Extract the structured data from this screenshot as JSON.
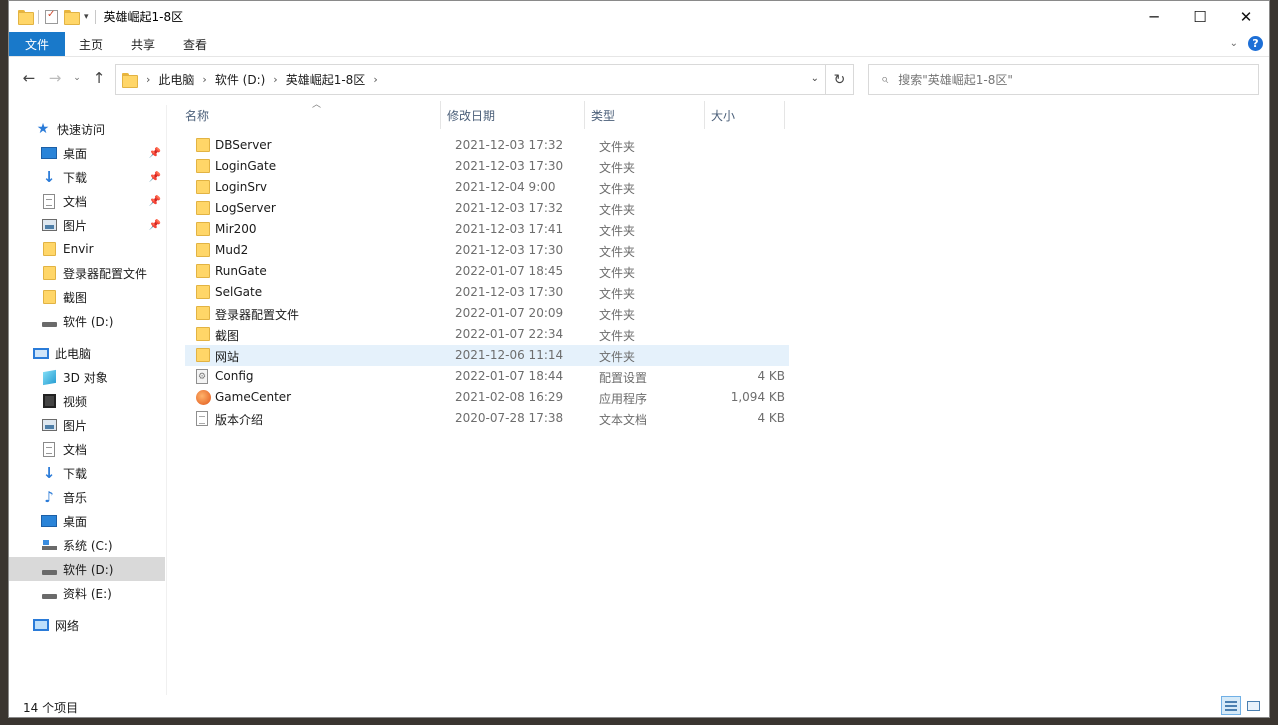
{
  "window": {
    "title": "英雄崛起1-8区",
    "controls": {
      "minimize": "─",
      "maximize": "☐",
      "close": "✕"
    }
  },
  "ribbon": {
    "tabs": [
      "文件",
      "主页",
      "共享",
      "查看"
    ],
    "help": "?"
  },
  "address": {
    "crumbs": [
      "此电脑",
      "软件 (D:)",
      "英雄崛起1-8区"
    ],
    "search_placeholder": "搜索\"英雄崛起1-8区\""
  },
  "sidebar": {
    "items": [
      {
        "label": "快速访问",
        "icon": "star-icon",
        "pinned": false
      },
      {
        "label": "桌面",
        "icon": "desktop-icon",
        "pinned": true
      },
      {
        "label": "下载",
        "icon": "download-icon",
        "pinned": true
      },
      {
        "label": "文档",
        "icon": "document-icon",
        "pinned": true
      },
      {
        "label": "图片",
        "icon": "pictures-icon",
        "pinned": true
      },
      {
        "label": "Envir",
        "icon": "folder-icon",
        "pinned": false
      },
      {
        "label": "登录器配置文件",
        "icon": "folder-icon",
        "pinned": false
      },
      {
        "label": "截图",
        "icon": "folder-icon",
        "pinned": false
      },
      {
        "label": "软件 (D:)",
        "icon": "drive-icon",
        "pinned": false
      },
      {
        "label": "此电脑",
        "icon": "computer-icon",
        "pinned": false
      },
      {
        "label": "3D 对象",
        "icon": "3d-objects-icon",
        "pinned": false
      },
      {
        "label": "视频",
        "icon": "video-icon",
        "pinned": false
      },
      {
        "label": "图片",
        "icon": "pictures-icon",
        "pinned": false
      },
      {
        "label": "文档",
        "icon": "document-icon",
        "pinned": false
      },
      {
        "label": "下载",
        "icon": "download-icon",
        "pinned": false
      },
      {
        "label": "音乐",
        "icon": "music-icon",
        "pinned": false
      },
      {
        "label": "桌面",
        "icon": "desktop-icon",
        "pinned": false
      },
      {
        "label": "系统 (C:)",
        "icon": "system-drive-icon",
        "pinned": false
      },
      {
        "label": "软件 (D:)",
        "icon": "drive-icon",
        "pinned": false,
        "selected": true
      },
      {
        "label": "资料 (E:)",
        "icon": "drive-icon",
        "pinned": false
      },
      {
        "label": "网络",
        "icon": "network-icon",
        "pinned": false
      }
    ]
  },
  "columns": {
    "name": "名称",
    "date": "修改日期",
    "type": "类型",
    "size": "大小"
  },
  "files": [
    {
      "name": "DBServer",
      "date": "2021-12-03 17:32",
      "type": "文件夹",
      "size": "",
      "icon": "folder-icon"
    },
    {
      "name": "LoginGate",
      "date": "2021-12-03 17:30",
      "type": "文件夹",
      "size": "",
      "icon": "folder-icon"
    },
    {
      "name": "LoginSrv",
      "date": "2021-12-04 9:00",
      "type": "文件夹",
      "size": "",
      "icon": "folder-icon"
    },
    {
      "name": "LogServer",
      "date": "2021-12-03 17:32",
      "type": "文件夹",
      "size": "",
      "icon": "folder-icon"
    },
    {
      "name": "Mir200",
      "date": "2021-12-03 17:41",
      "type": "文件夹",
      "size": "",
      "icon": "folder-icon"
    },
    {
      "name": "Mud2",
      "date": "2021-12-03 17:30",
      "type": "文件夹",
      "size": "",
      "icon": "folder-icon"
    },
    {
      "name": "RunGate",
      "date": "2022-01-07 18:45",
      "type": "文件夹",
      "size": "",
      "icon": "folder-icon"
    },
    {
      "name": "SelGate",
      "date": "2021-12-03 17:30",
      "type": "文件夹",
      "size": "",
      "icon": "folder-icon"
    },
    {
      "name": "登录器配置文件",
      "date": "2022-01-07 20:09",
      "type": "文件夹",
      "size": "",
      "icon": "folder-icon"
    },
    {
      "name": "截图",
      "date": "2022-01-07 22:34",
      "type": "文件夹",
      "size": "",
      "icon": "folder-icon"
    },
    {
      "name": "网站",
      "date": "2021-12-06 11:14",
      "type": "文件夹",
      "size": "",
      "icon": "folder-icon",
      "selected": true
    },
    {
      "name": "Config",
      "date": "2022-01-07 18:44",
      "type": "配置设置",
      "size": "4 KB",
      "icon": "config-file-icon"
    },
    {
      "name": "GameCenter",
      "date": "2021-02-08 16:29",
      "type": "应用程序",
      "size": "1,094 KB",
      "icon": "application-icon"
    },
    {
      "name": "版本介绍",
      "date": "2020-07-28 17:38",
      "type": "文本文档",
      "size": "4 KB",
      "icon": "text-file-icon"
    }
  ],
  "status": {
    "count": "14 个项目"
  }
}
